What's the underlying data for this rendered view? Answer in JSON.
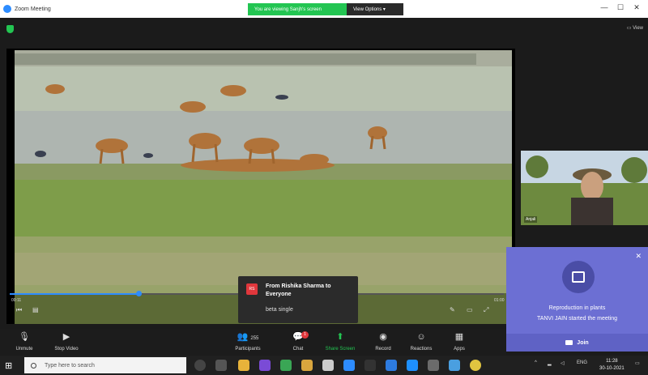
{
  "window": {
    "title": "Zoom Meeting",
    "viewing_banner": "You are viewing Sanjh's screen",
    "view_options": "View Options ▾",
    "controls": [
      "—",
      "☐",
      "✕"
    ]
  },
  "top_right_toggle": "▭ View",
  "shared_screen": {
    "current_time": "00:11",
    "total_time": "01:00",
    "progress": 0.26
  },
  "participant": {
    "name": "Anjali"
  },
  "chat_popup": {
    "avatar_initials": "RS",
    "from": "From Rishika Sharma to Everyone",
    "message": "beta single"
  },
  "notification": {
    "title": "Reproduction in plants",
    "subtitle": "TANVI JAIN started the meeting",
    "join_label": "Join"
  },
  "toolbar": {
    "items": [
      {
        "label": "Unmute",
        "icon": "mic-muted-icon"
      },
      {
        "label": "Stop Video",
        "icon": "video-icon"
      },
      {
        "label": "Participants",
        "icon": "participants-icon",
        "count": "255"
      },
      {
        "label": "Chat",
        "icon": "chat-icon",
        "badge": "1"
      },
      {
        "label": "Share Screen",
        "icon": "share-screen-icon"
      },
      {
        "label": "Record",
        "icon": "record-icon"
      },
      {
        "label": "Reactions",
        "icon": "reactions-icon"
      },
      {
        "label": "Apps",
        "icon": "apps-icon"
      }
    ]
  },
  "taskbar": {
    "search_placeholder": "Type here to search",
    "lang": "ENG",
    "time": "11:28",
    "date": "30-10-2021"
  },
  "colors": {
    "share_green": "#23c552",
    "notification_purple": "#6c6fd3",
    "zoom_blue": "#2d8cff"
  }
}
